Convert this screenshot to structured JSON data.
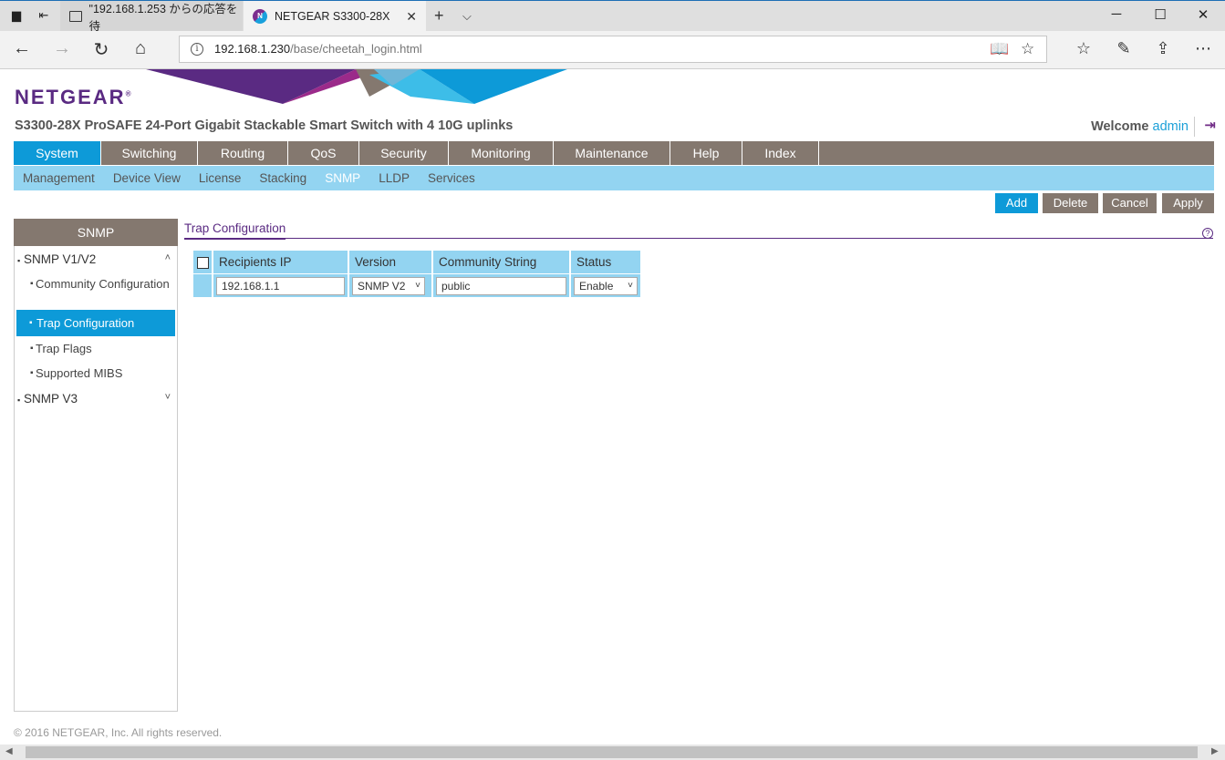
{
  "browser": {
    "tabs": [
      {
        "title": "\"192.168.1.253 からの応答を待"
      },
      {
        "title": "NETGEAR S3300-28X"
      }
    ],
    "url_host": "192.168.1.230",
    "url_path": "/base/cheetah_login.html"
  },
  "header": {
    "logo": "NETGEAR",
    "logo_mark": "®",
    "product": "S3300-28X ProSAFE 24-Port Gigabit Stackable Smart Switch with 4 10G uplinks",
    "welcome": "Welcome",
    "user": "admin"
  },
  "main_nav": [
    {
      "label": "System",
      "active": true
    },
    {
      "label": "Switching"
    },
    {
      "label": "Routing"
    },
    {
      "label": "QoS"
    },
    {
      "label": "Security"
    },
    {
      "label": "Monitoring"
    },
    {
      "label": "Maintenance"
    },
    {
      "label": "Help"
    },
    {
      "label": "Index"
    }
  ],
  "sub_nav": [
    {
      "label": "Management"
    },
    {
      "label": "Device View"
    },
    {
      "label": "License"
    },
    {
      "label": "Stacking"
    },
    {
      "label": "SNMP",
      "active": true
    },
    {
      "label": "LLDP"
    },
    {
      "label": "Services"
    }
  ],
  "actions": {
    "add": "Add",
    "delete": "Delete",
    "cancel": "Cancel",
    "apply": "Apply"
  },
  "sidebar": {
    "title": "SNMP",
    "section1": "SNMP V1/V2",
    "items": [
      "Community Configuration",
      "Trap Configuration",
      "Trap Flags",
      "Supported MIBS"
    ],
    "section2": "SNMP V3"
  },
  "content": {
    "title": "Trap Configuration",
    "columns": [
      "Recipients IP",
      "Version",
      "Community String",
      "Status"
    ],
    "row": {
      "recipients_ip": "192.168.1.1",
      "version": "SNMP V2",
      "community": "public",
      "status": "Enable"
    }
  },
  "footer": "© 2016 NETGEAR, Inc. All rights reserved."
}
